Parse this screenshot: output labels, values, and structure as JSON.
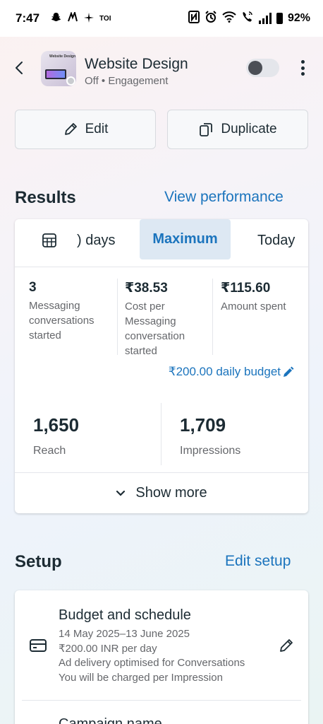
{
  "status_bar": {
    "time": "7:47",
    "toi": "TOI",
    "battery": "92%"
  },
  "header": {
    "thumb_text": "Website Design",
    "title": "Website Design",
    "subtitle": "Off • Engagement",
    "toggle_state": "off"
  },
  "actions": {
    "edit_label": "Edit",
    "duplicate_label": "Duplicate"
  },
  "results": {
    "section_title": "Results",
    "link": "View performance",
    "segments": {
      "days_label": ") days",
      "maximum_label": "Maximum",
      "today_label": "Today",
      "selected": "Maximum"
    },
    "metrics": [
      {
        "value": "3",
        "label": "Messaging conversations started"
      },
      {
        "value": "₹38.53",
        "label": "Cost per Messaging conversation started"
      },
      {
        "value": "₹115.60",
        "label": "Amount spent"
      }
    ],
    "budget": "₹200.00 daily budget",
    "reach": {
      "value": "1,650",
      "label": "Reach"
    },
    "impressions": {
      "value": "1,709",
      "label": "Impressions"
    },
    "show_more": "Show more"
  },
  "setup": {
    "section_title": "Setup",
    "link": "Edit setup",
    "budget_title": "Budget and schedule",
    "dates": "14 May 2025–13 June 2025",
    "amount": "₹200.00 INR per day",
    "optimisation": "Ad delivery optimised for Conversations",
    "charging": "You will be charged per Impression",
    "next_item": "Campaign name"
  },
  "colors": {
    "accent": "#1b74bd",
    "selected_segment_bg": "#dde8f3",
    "text_primary": "#1c2b33",
    "text_secondary": "#65676b"
  }
}
